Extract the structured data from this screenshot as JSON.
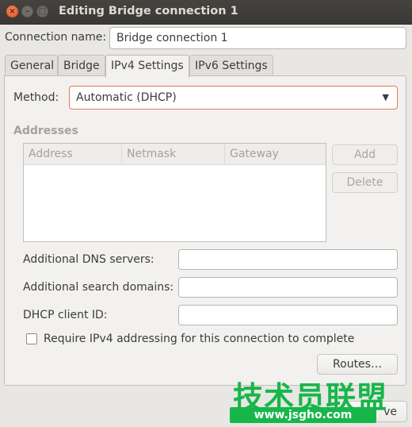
{
  "window": {
    "title": "Editing Bridge connection 1",
    "close_glyph": "×",
    "minimize_glyph": "–",
    "maximize_glyph": "□"
  },
  "connection": {
    "name_label": "Connection name:",
    "name_value": "Bridge connection 1"
  },
  "tabs": [
    {
      "label": "General"
    },
    {
      "label": "Bridge"
    },
    {
      "label": "IPv4 Settings"
    },
    {
      "label": "IPv6 Settings"
    }
  ],
  "active_tab": "IPv4 Settings",
  "ipv4": {
    "method_label": "Method:",
    "method_value": "Automatic (DHCP)",
    "addresses_heading": "Addresses",
    "columns": [
      "Address",
      "Netmask",
      "Gateway"
    ],
    "add_button": "Add",
    "delete_button": "Delete",
    "dns_label": "Additional DNS servers:",
    "search_label": "Additional search domains:",
    "dhcp_label": "DHCP client ID:",
    "require_label": "Require IPv4 addressing for this connection to complete",
    "require_checked": false,
    "routes_button": "Routes…"
  },
  "footer": {
    "save_partial": "ve"
  },
  "watermark": {
    "text_large": "技术员联盟",
    "text_small": "www.jsgho.com"
  },
  "colors": {
    "titlebar": "#3f3e3a",
    "close_button": "#df4a16",
    "combo_focus_border": "#e6785a",
    "watermark_green": "#17b64a"
  }
}
